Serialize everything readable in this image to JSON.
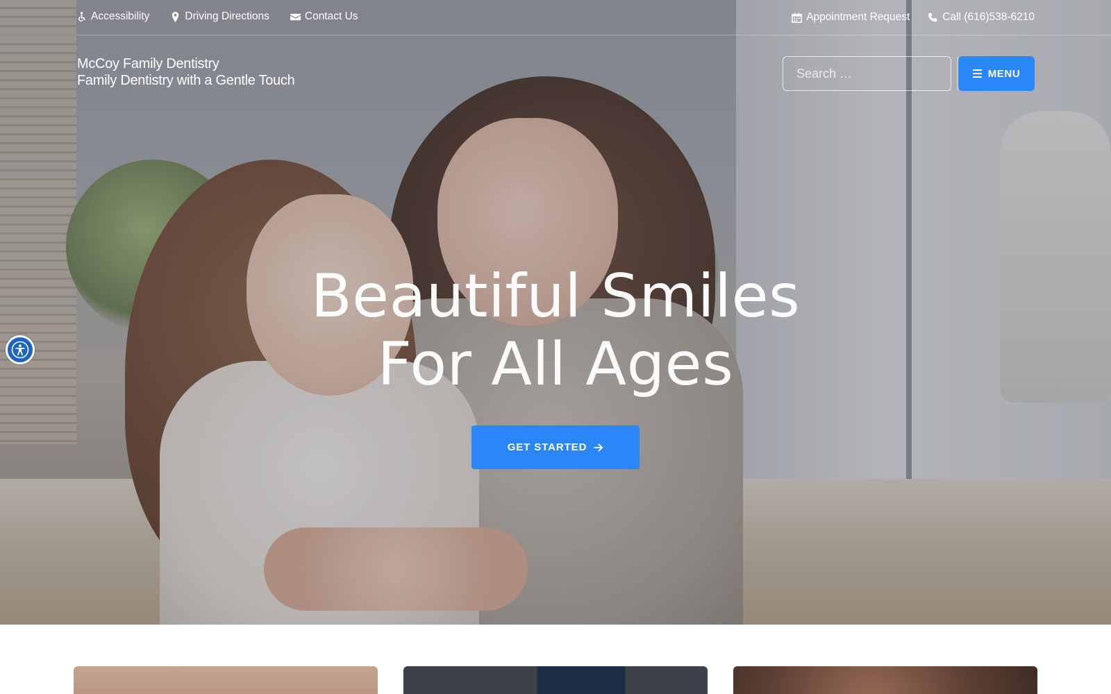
{
  "topbar": {
    "left_links": [
      {
        "label": "Accessibility",
        "icon": "wheelchair-icon"
      },
      {
        "label": "Driving Directions",
        "icon": "map-marker-icon"
      },
      {
        "label": "Contact Us",
        "icon": "envelope-icon"
      }
    ],
    "right_links": [
      {
        "label": "Appointment Request",
        "icon": "calendar-icon"
      },
      {
        "label": "Call (616)538-6210",
        "icon": "phone-icon"
      }
    ]
  },
  "brand": {
    "name": "McCoy Family Dentistry",
    "tagline": "Family Dentistry with a Gentle Touch"
  },
  "search": {
    "placeholder": "Search …",
    "button_icon": "search-icon"
  },
  "menu": {
    "label": "MENU",
    "icon": "hamburger-icon"
  },
  "hero": {
    "headline_line1": "Beautiful Smiles",
    "headline_line2": "For All Ages",
    "cta_label": "GET STARTED",
    "cta_icon": "arrow-right-icon"
  },
  "accessibility_widget": {
    "icon": "accessibility-person-icon"
  },
  "colors": {
    "accent": "#2b87f7",
    "widget": "#1e63c4",
    "text": "#ffffff"
  }
}
